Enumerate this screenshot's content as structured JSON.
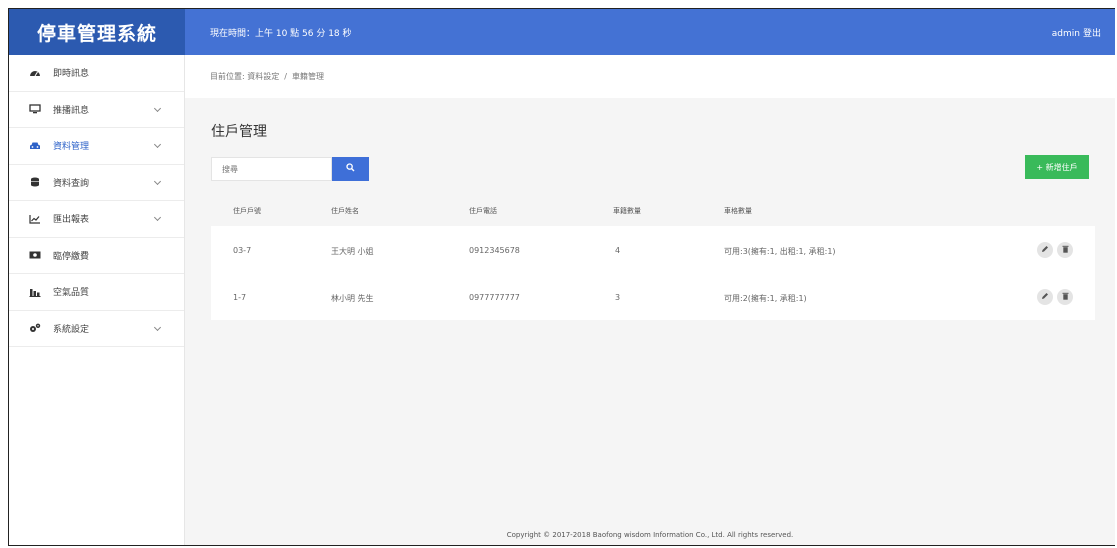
{
  "app": {
    "title": "停車管理系統"
  },
  "header": {
    "clock": "現在時間：上午 10 點 56 分 18 秒",
    "user": "admin",
    "logout": "登出"
  },
  "sidebar": {
    "items": [
      {
        "label": "即時訊息",
        "icon": "dashboard-icon"
      },
      {
        "label": "推播訊息",
        "icon": "monitor-icon"
      },
      {
        "label": "資料管理",
        "icon": "car-icon"
      },
      {
        "label": "資料查詢",
        "icon": "database-icon"
      },
      {
        "label": "匯出報表",
        "icon": "line-chart-icon"
      },
      {
        "label": "臨停繳費",
        "icon": "money-icon"
      },
      {
        "label": "空氣品質",
        "icon": "bar-chart-icon"
      },
      {
        "label": "系統設定",
        "icon": "cogs-icon"
      }
    ]
  },
  "breadcrumb": {
    "prefix": "目前位置:",
    "level1": "資料設定",
    "sep": "/",
    "level2": "車籍管理"
  },
  "page": {
    "title": "住戶管理"
  },
  "search": {
    "placeholder": "搜尋"
  },
  "toolbar": {
    "add_label": "+ 新增住戶"
  },
  "table": {
    "headers": [
      "住戶戶號",
      "住戶姓名",
      "住戶電話",
      "車籍數量",
      "車格數量"
    ],
    "rows": [
      [
        "03-7",
        "王大明 小姐",
        "0912345678",
        "4",
        "可用:3(擁有:1, 出租:1, 承租:1)"
      ],
      [
        "1-7",
        "林小明 先生",
        "0977777777",
        "3",
        "可用:2(擁有:1, 承租:1)"
      ]
    ]
  },
  "footer": {
    "copyright": "Copyright © 2017-2018 Baofong wisdom Information Co., Ltd. All rights reserved."
  },
  "colors": {
    "brand": "#2c5ab0",
    "header": "#4472d4",
    "active": "#2d62c8",
    "success": "#39ba5a"
  }
}
